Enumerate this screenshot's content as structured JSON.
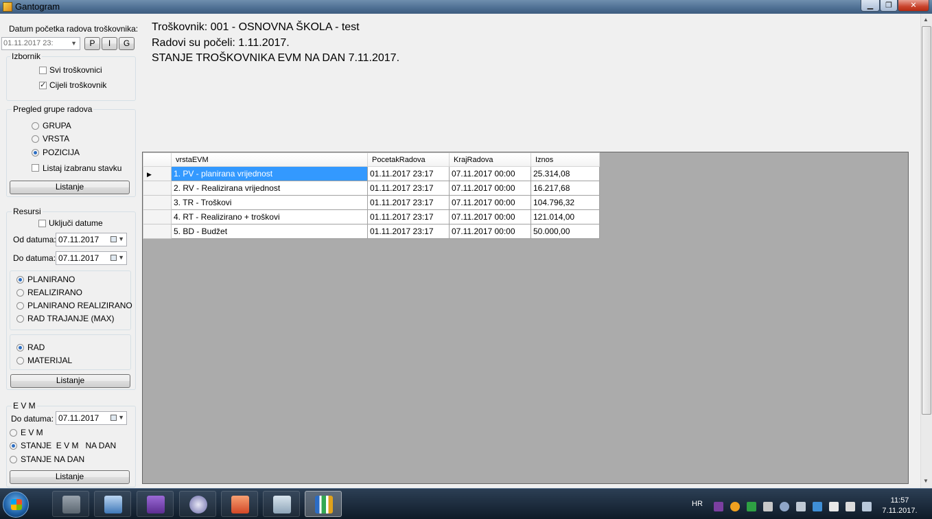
{
  "window": {
    "title": "Gantogram"
  },
  "left_panel": {
    "start_date_label": "Datum početka radova troškovnika:",
    "start_date_value": "01.11.2017 23:",
    "buttons": [
      "P",
      "I",
      "G"
    ],
    "izbornik": {
      "title": "Izbornik",
      "svi": {
        "label": "Svi troškovnici",
        "checked": false
      },
      "cijeli": {
        "label": "Cijeli troškovnik",
        "checked": true
      }
    },
    "pregled": {
      "title": "Pregled grupe radova",
      "options": [
        {
          "label": "GRUPA",
          "selected": false
        },
        {
          "label": "VRSTA",
          "selected": false
        },
        {
          "label": "POZICIJA",
          "selected": true
        }
      ],
      "listaj_label": "Listaj izabranu stavku",
      "listanje_label": "Listanje"
    },
    "resursi": {
      "title": "Resursi",
      "ukljuci_label": "Uključi datume",
      "od_label": "Od datuma:",
      "od_value": "07.11.2017",
      "do_label": "Do datuma:",
      "do_value": "07.11.2017",
      "mode_options": [
        {
          "label": "PLANIRANO",
          "selected": true
        },
        {
          "label": "REALIZIRANO",
          "selected": false
        },
        {
          "label": "PLANIRANO REALIZIRANO",
          "selected": false
        },
        {
          "label": "RAD TRAJANJE (MAX)",
          "selected": false
        }
      ],
      "type_options": [
        {
          "label": "RAD",
          "selected": true
        },
        {
          "label": "MATERIJAL",
          "selected": false
        }
      ],
      "listanje_label": "Listanje"
    },
    "evm": {
      "title": "E V M",
      "do_label": "Do datuma:",
      "do_value": "07.11.2017",
      "options": [
        {
          "label": "E V M",
          "selected": false
        },
        {
          "label": "STANJE  E V M   NA DAN",
          "selected": true
        },
        {
          "label": "STANJE NA DAN",
          "selected": false
        }
      ],
      "listanje_label": "Listanje"
    }
  },
  "header": {
    "line1": "Troškovnik: 001 - OSNOVNA ŠKOLA - test",
    "line2": "Radovi su počeli: 1.11.2017.",
    "line3": "STANJE TROŠKOVNIKA EVM NA DAN 7.11.2017."
  },
  "grid": {
    "columns": [
      "vrstaEVM",
      "PocetakRadova",
      "KrajRadova",
      "Iznos"
    ],
    "rows": [
      [
        "1. PV - planirana vrijednost",
        "01.11.2017 23:17",
        "07.11.2017 00:00",
        "25.314,08"
      ],
      [
        "2. RV - Realizirana vrijednost",
        "01.11.2017 23:17",
        "07.11.2017 00:00",
        "16.217,68"
      ],
      [
        "3. TR - Troškovi",
        "01.11.2017 23:17",
        "07.11.2017 00:00",
        "104.796,32"
      ],
      [
        "4. RT - Realizirano + troškovi",
        "01.11.2017 23:17",
        "07.11.2017 00:00",
        "121.014,00"
      ],
      [
        "5. BD - Budžet",
        "01.11.2017 23:17",
        "07.11.2017 00:00",
        "50.000,00"
      ]
    ]
  },
  "taskbar": {
    "lang": "HR",
    "time": "11:57",
    "date": "7.11.2017.",
    "apps": [
      "server-manager-icon",
      "network-computer-icon",
      "visual-studio-icon",
      "media-player-icon",
      "powerpoint-icon",
      "windows-server-icon",
      "chart-app-icon"
    ]
  }
}
